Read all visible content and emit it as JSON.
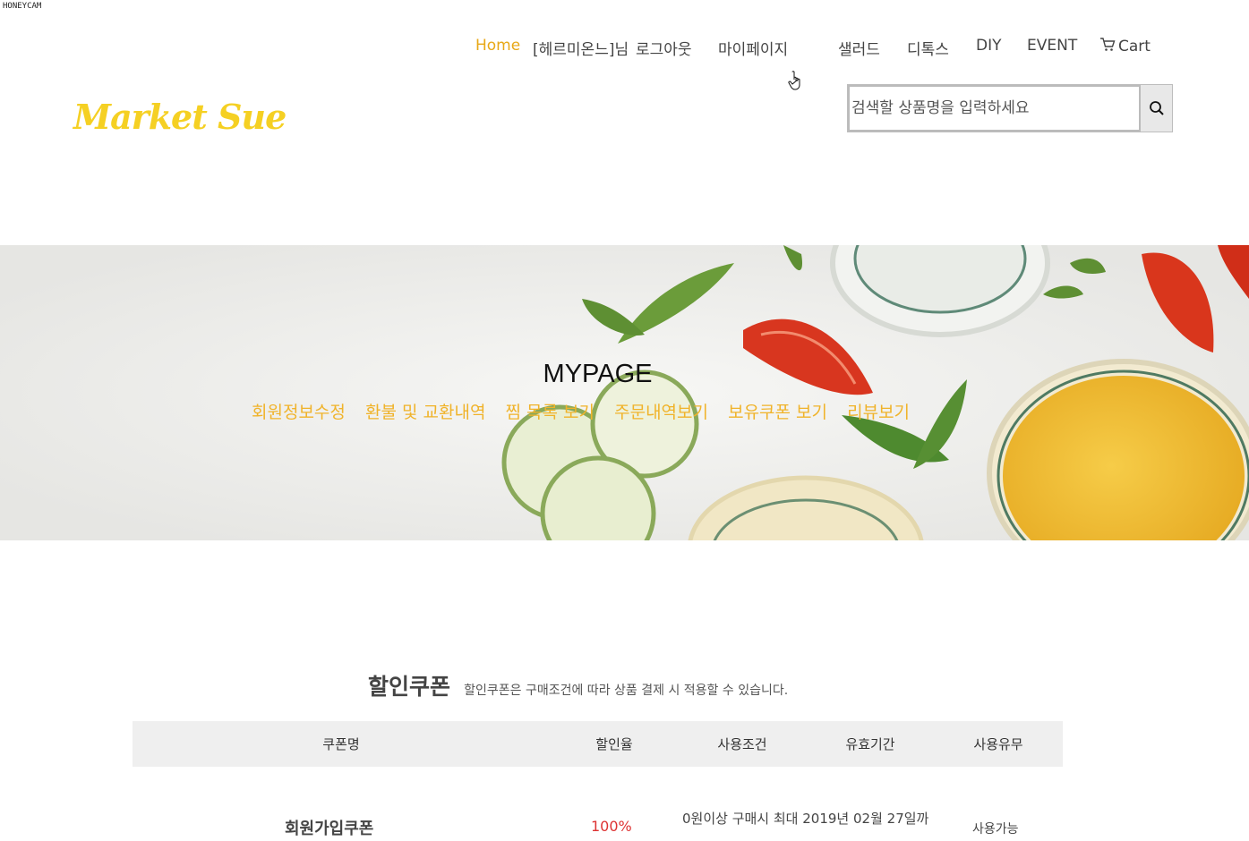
{
  "watermark": "HONEYCAM",
  "nav": {
    "home": "Home",
    "user": "[헤르미온느]님",
    "logout": "로그아웃",
    "mypage": "마이페이지",
    "salad": "샐러드",
    "detox": "디톡스",
    "diy": "DIY",
    "event": "EVENT",
    "cart": "Cart"
  },
  "logo": "Market Sue",
  "search": {
    "placeholder": "검색할 상품명을 입력하세요"
  },
  "banner": {
    "title": "MYPAGE",
    "links": [
      "회원정보수정",
      "환불 및 교환내역",
      "찜 목록 보기",
      "주문내역보기",
      "보유쿠폰 보기",
      "리뷰보기"
    ]
  },
  "coupon": {
    "heading": "할인쿠폰",
    "subheading": "할인쿠폰은 구매조건에 따라 상품 결제 시 적용할 수 있습니다.",
    "columns": [
      "쿠폰명",
      "할인율",
      "사용조건",
      "유효기간",
      "사용유무"
    ],
    "rows": [
      {
        "name": "회원가입쿠폰",
        "rate": "100%",
        "condition": "0원이상 구매시 최대 2019년 02월 27일까",
        "validity": "",
        "status": "사용가능"
      }
    ]
  },
  "colors": {
    "accent": "#e8a817",
    "logo": "#f5d023",
    "banner_link": "#f0b32a"
  }
}
